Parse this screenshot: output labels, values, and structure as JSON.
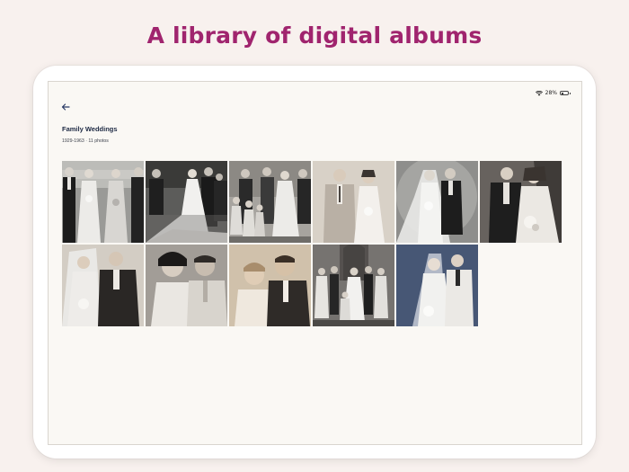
{
  "headline": "A library of digital albums",
  "status_bar": {
    "battery": "28%",
    "battery_level": 0.28,
    "icons": [
      "wifi-icon",
      "battery-icon"
    ]
  },
  "back_icon": "arrow-left-icon",
  "album": {
    "title": "Family Weddings",
    "meta": "1929-1963 · 11 photos"
  },
  "photos": [
    {
      "subject": "wedding party in a row",
      "tone": "gray"
    },
    {
      "subject": "bride with long veil and guests",
      "tone": "gray"
    },
    {
      "subject": "large wedding party with bridesmaids",
      "tone": "gray"
    },
    {
      "subject": "couple in light suit and dress",
      "tone": "warm"
    },
    {
      "subject": "bride with veil and groom",
      "tone": "gray"
    },
    {
      "subject": "couple with bouquet",
      "tone": "gray"
    },
    {
      "subject": "bride with veil and groom in suit",
      "tone": "warm"
    },
    {
      "subject": "couple portrait close-up",
      "tone": "gray"
    },
    {
      "subject": "1920s couple portrait",
      "tone": "sepia"
    },
    {
      "subject": "wedding group at church door",
      "tone": "gray"
    },
    {
      "subject": "couple with bouquet, blue tint",
      "tone": "blue"
    }
  ],
  "colors": {
    "headline": "#a0246e",
    "title": "#1e2a44",
    "background": "#f8f1ee",
    "screen": "#faf8f4"
  }
}
